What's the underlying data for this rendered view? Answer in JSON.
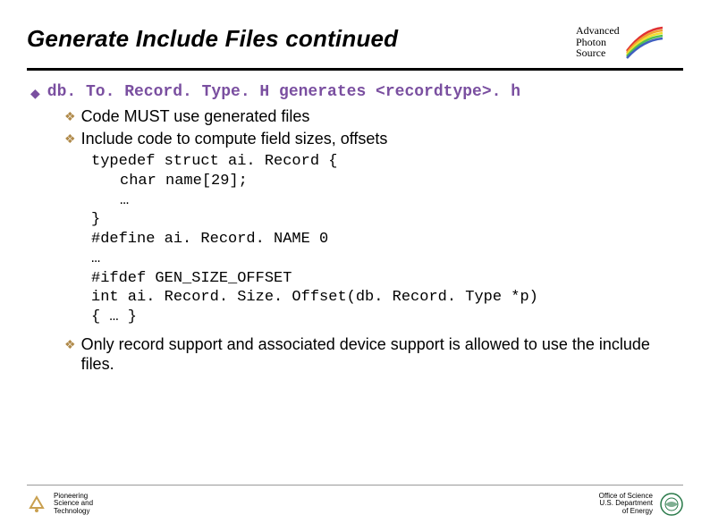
{
  "title": "Generate Include Files continued",
  "aps": {
    "l1": "Advanced",
    "l2": "Photon",
    "l3": "Source"
  },
  "bullet1": "db. To. Record. Type. H generates <recordtype>. h",
  "sub1": "Code MUST use generated files",
  "sub2": "Include code to compute field sizes, offsets",
  "code": {
    "l1": "typedef struct ai. Record {",
    "l2": "char name[29];",
    "l3": "…",
    "l4": "}",
    "l5": "#define ai. Record. NAME 0",
    "l6": "…",
    "l7": "#ifdef GEN_SIZE_OFFSET",
    "l8": "int ai. Record. Size. Offset(db. Record. Type *p)",
    "l9": "{ … }"
  },
  "sub3": "Only record support and associated device support is allowed to use the include files.",
  "footer": {
    "left": {
      "l1": "Pioneering",
      "l2": "Science and",
      "l3": "Technology"
    },
    "right": {
      "l1": "Office of Science",
      "l2": "U.S. Department",
      "l3": "of Energy"
    }
  }
}
